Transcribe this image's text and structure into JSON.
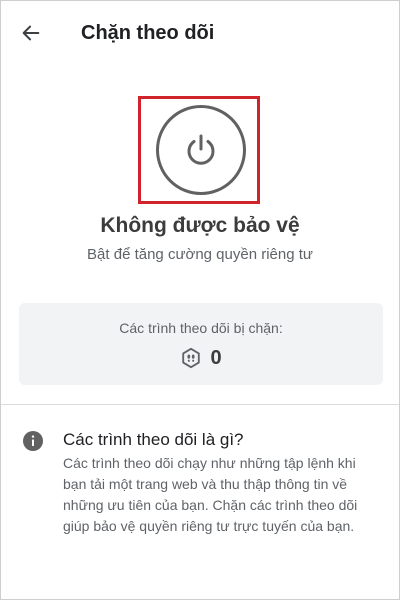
{
  "header": {
    "back_icon": "arrow-left-icon",
    "title": "Chặn theo dõi"
  },
  "protection": {
    "power_icon": "power-icon",
    "highlight_color": "#d0232b",
    "status_title": "Không được bảo vệ",
    "status_subtitle": "Bật để tăng cường quyền riêng tư"
  },
  "blocked_card": {
    "label": "Các trình theo dõi bị chặn:",
    "icon": "footprints-shield-icon",
    "count": "0"
  },
  "info": {
    "icon": "info-icon",
    "title": "Các trình theo dõi là gì?",
    "description": "Các trình theo dõi chạy như những tập lệnh khi bạn tải một trang web và thu thập thông tin về những ưu tiên của bạn. Chặn các trình theo dõi giúp bảo vệ quyền riêng tư trực tuyến của bạn."
  }
}
